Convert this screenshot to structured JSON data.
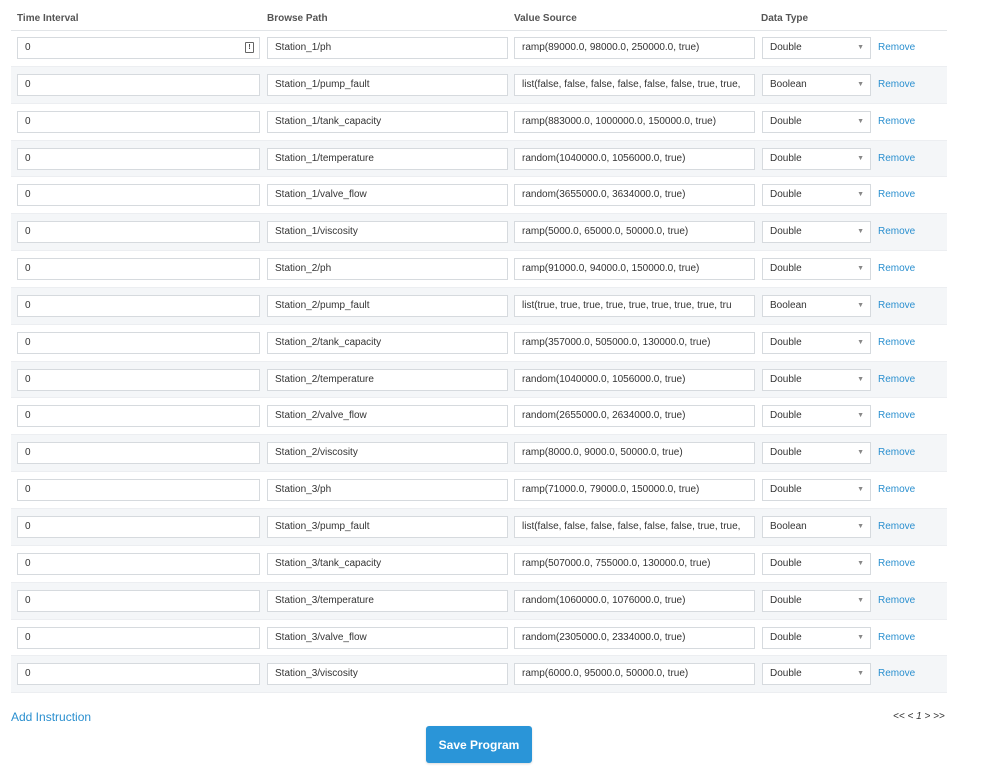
{
  "headers": {
    "time_interval": "Time Interval",
    "browse_path": "Browse Path",
    "value_source": "Value Source",
    "data_type": "Data Type"
  },
  "remove_label": "Remove",
  "rows": [
    {
      "time": "0",
      "path": "Station_1/ph",
      "value": "ramp(89000.0, 98000.0, 250000.0, true)",
      "type": "Double"
    },
    {
      "time": "0",
      "path": "Station_1/pump_fault",
      "value": "list(false, false, false, false, false, false, true, true,",
      "type": "Boolean"
    },
    {
      "time": "0",
      "path": "Station_1/tank_capacity",
      "value": "ramp(883000.0, 1000000.0, 150000.0, true)",
      "type": "Double"
    },
    {
      "time": "0",
      "path": "Station_1/temperature",
      "value": "random(1040000.0, 1056000.0, true)",
      "type": "Double"
    },
    {
      "time": "0",
      "path": "Station_1/valve_flow",
      "value": "random(3655000.0, 3634000.0, true)",
      "type": "Double"
    },
    {
      "time": "0",
      "path": "Station_1/viscosity",
      "value": "ramp(5000.0, 65000.0, 50000.0, true)",
      "type": "Double"
    },
    {
      "time": "0",
      "path": "Station_2/ph",
      "value": "ramp(91000.0, 94000.0, 150000.0, true)",
      "type": "Double"
    },
    {
      "time": "0",
      "path": "Station_2/pump_fault",
      "value": "list(true, true, true, true, true, true, true, true, tru",
      "type": "Boolean"
    },
    {
      "time": "0",
      "path": "Station_2/tank_capacity",
      "value": "ramp(357000.0, 505000.0, 130000.0, true)",
      "type": "Double"
    },
    {
      "time": "0",
      "path": "Station_2/temperature",
      "value": "random(1040000.0, 1056000.0, true)",
      "type": "Double"
    },
    {
      "time": "0",
      "path": "Station_2/valve_flow",
      "value": "random(2655000.0, 2634000.0, true)",
      "type": "Double"
    },
    {
      "time": "0",
      "path": "Station_2/viscosity",
      "value": "ramp(8000.0, 9000.0, 50000.0, true)",
      "type": "Double"
    },
    {
      "time": "0",
      "path": "Station_3/ph",
      "value": "ramp(71000.0, 79000.0, 150000.0, true)",
      "type": "Double"
    },
    {
      "time": "0",
      "path": "Station_3/pump_fault",
      "value": "list(false, false, false, false, false, false, true, true,",
      "type": "Boolean"
    },
    {
      "time": "0",
      "path": "Station_3/tank_capacity",
      "value": "ramp(507000.0, 755000.0, 130000.0, true)",
      "type": "Double"
    },
    {
      "time": "0",
      "path": "Station_3/temperature",
      "value": "random(1060000.0, 1076000.0, true)",
      "type": "Double"
    },
    {
      "time": "0",
      "path": "Station_3/valve_flow",
      "value": "random(2305000.0, 2334000.0, true)",
      "type": "Double"
    },
    {
      "time": "0",
      "path": "Station_3/viscosity",
      "value": "ramp(6000.0, 95000.0, 50000.0, true)",
      "type": "Double"
    }
  ],
  "add_instruction": "Add Instruction",
  "pager": {
    "first": "<<",
    "prev": "<",
    "page": "1",
    "next": ">",
    "last": ">>"
  },
  "save_button": "Save Program",
  "colors": {
    "link": "#2a8fcf",
    "button": "#2a95d8",
    "stripe": "#f4f6f8"
  }
}
